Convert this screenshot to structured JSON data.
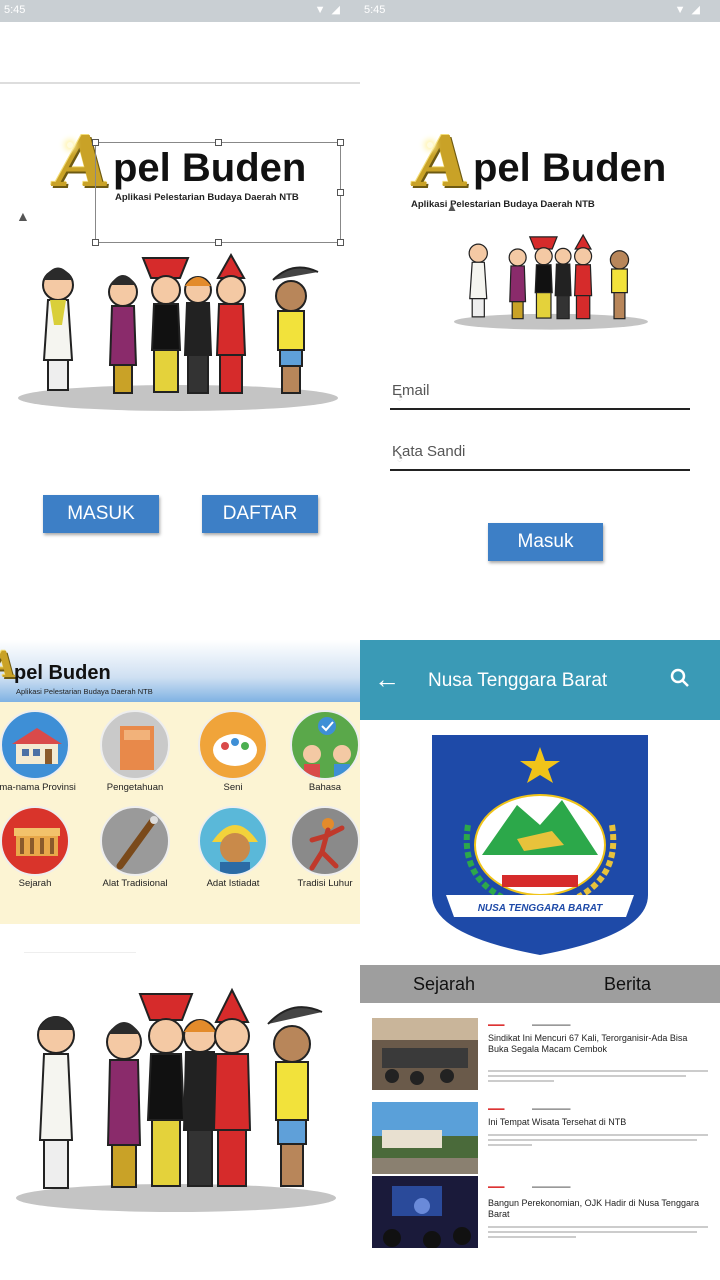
{
  "status": {
    "time": "5:45"
  },
  "brand": {
    "name": "pel Buden",
    "initial": "A",
    "tagline": "Aplikasi Pelestarian Budaya Daerah NTB"
  },
  "landing": {
    "login_label": "MASUK",
    "register_label": "DAFTAR"
  },
  "login": {
    "email_placeholder": "Email",
    "password_placeholder": "Kata Sandi",
    "submit_label": "Masuk"
  },
  "menu": {
    "categories": [
      {
        "label": "ama-nama Provinsi",
        "icon": "house-icon"
      },
      {
        "label": "Pengetahuan",
        "icon": "book-icon"
      },
      {
        "label": "Seni",
        "icon": "palette-icon"
      },
      {
        "label": "Bahasa",
        "icon": "people-talk-icon"
      },
      {
        "label": "Sejarah",
        "icon": "monument-icon"
      },
      {
        "label": "Alat Tradisional",
        "icon": "traditional-tool-icon"
      },
      {
        "label": "Adat Istiadat",
        "icon": "tribal-person-icon"
      },
      {
        "label": "Tradisi Luhur",
        "icon": "dance-icon"
      }
    ]
  },
  "province": {
    "title": "Nusa Tenggara Barat",
    "emblem_banner": "NUSA TENGGARA BARAT",
    "tabs": [
      "Sejarah",
      "Berita"
    ],
    "news": [
      {
        "headline": "Sindikat Ini Mencuri 67 Kali, Terorganisir-Ada Bisa Buka Segala Macam Cembok"
      },
      {
        "headline": "Ini Tempat Wisata Tersehat di NTB"
      },
      {
        "headline": "Bangun Perekonomian, OJK Hadir di Nusa Tenggara Barat"
      }
    ]
  },
  "colors": {
    "accent": "#3d7fc6",
    "appbar": "#3a9ab6",
    "menu_bg": "#fcf4d3"
  }
}
